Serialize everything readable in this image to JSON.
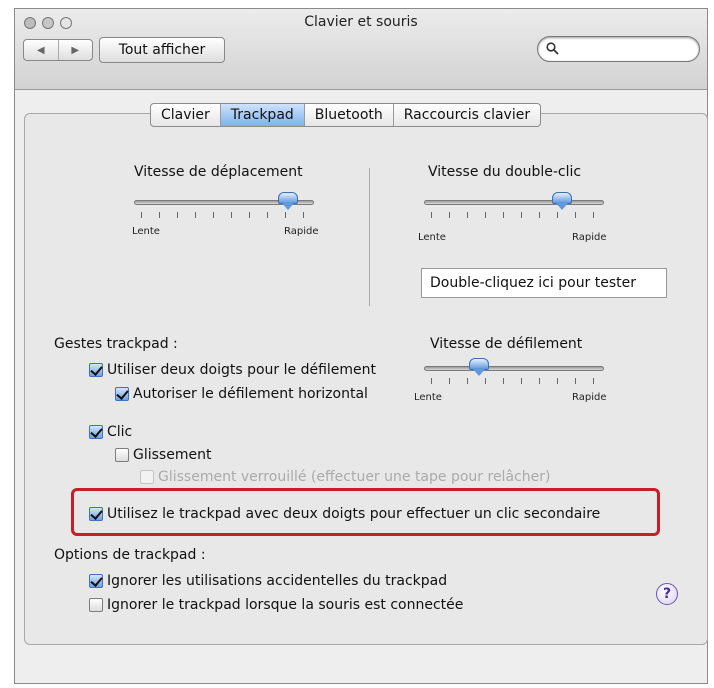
{
  "window": {
    "title": "Clavier et souris"
  },
  "toolbar": {
    "back_glyph": "◀",
    "forward_glyph": "▶",
    "show_all_label": "Tout afficher",
    "search_value": ""
  },
  "tabs": [
    {
      "label": "Clavier",
      "active": false
    },
    {
      "label": "Trackpad",
      "active": true
    },
    {
      "label": "Bluetooth",
      "active": false
    },
    {
      "label": "Raccourcis clavier",
      "active": false
    }
  ],
  "tracking_speed": {
    "label": "Vitesse de déplacement",
    "min_label": "Lente",
    "max_label": "Rapide",
    "value": 0.86
  },
  "double_click_speed": {
    "label": "Vitesse du double-clic",
    "min_label": "Lente",
    "max_label": "Rapide",
    "value": 0.8,
    "test_area_text": "Double-cliquez ici pour tester"
  },
  "gestures": {
    "heading": "Gestes trackpad :",
    "two_finger_scroll": {
      "label": "Utiliser deux doigts pour le défilement",
      "checked": true
    },
    "horizontal_scroll": {
      "label": "Autoriser le défilement horizontal",
      "checked": true
    },
    "clic": {
      "label": "Clic",
      "checked": true
    },
    "glissement": {
      "label": "Glissement",
      "checked": false
    },
    "glissement_verrouille": {
      "label": "Glissement verrouillé (effectuer une tape pour relâcher)",
      "checked": false,
      "enabled": false
    },
    "secondary_click": {
      "label": "Utilisez le trackpad avec deux doigts pour effectuer un clic secondaire",
      "checked": true
    }
  },
  "scroll_speed": {
    "label": "Vitesse de défilement",
    "min_label": "Lente",
    "max_label": "Rapide",
    "value": 0.3
  },
  "options": {
    "heading": "Options de trackpad :",
    "ignore_accidental": {
      "label": "Ignorer les utilisations accidentelles du trackpad",
      "checked": true
    },
    "ignore_when_mouse": {
      "label": "Ignorer le trackpad lorsque la souris est connectée",
      "checked": false
    }
  },
  "help": {
    "glyph": "?"
  },
  "colors": {
    "highlight": "#c81e2a",
    "accent": "#5f98dc"
  },
  "icons": [
    "back-arrow-icon",
    "forward-arrow-icon",
    "search-icon",
    "help-icon",
    "checkmark-icon"
  ]
}
